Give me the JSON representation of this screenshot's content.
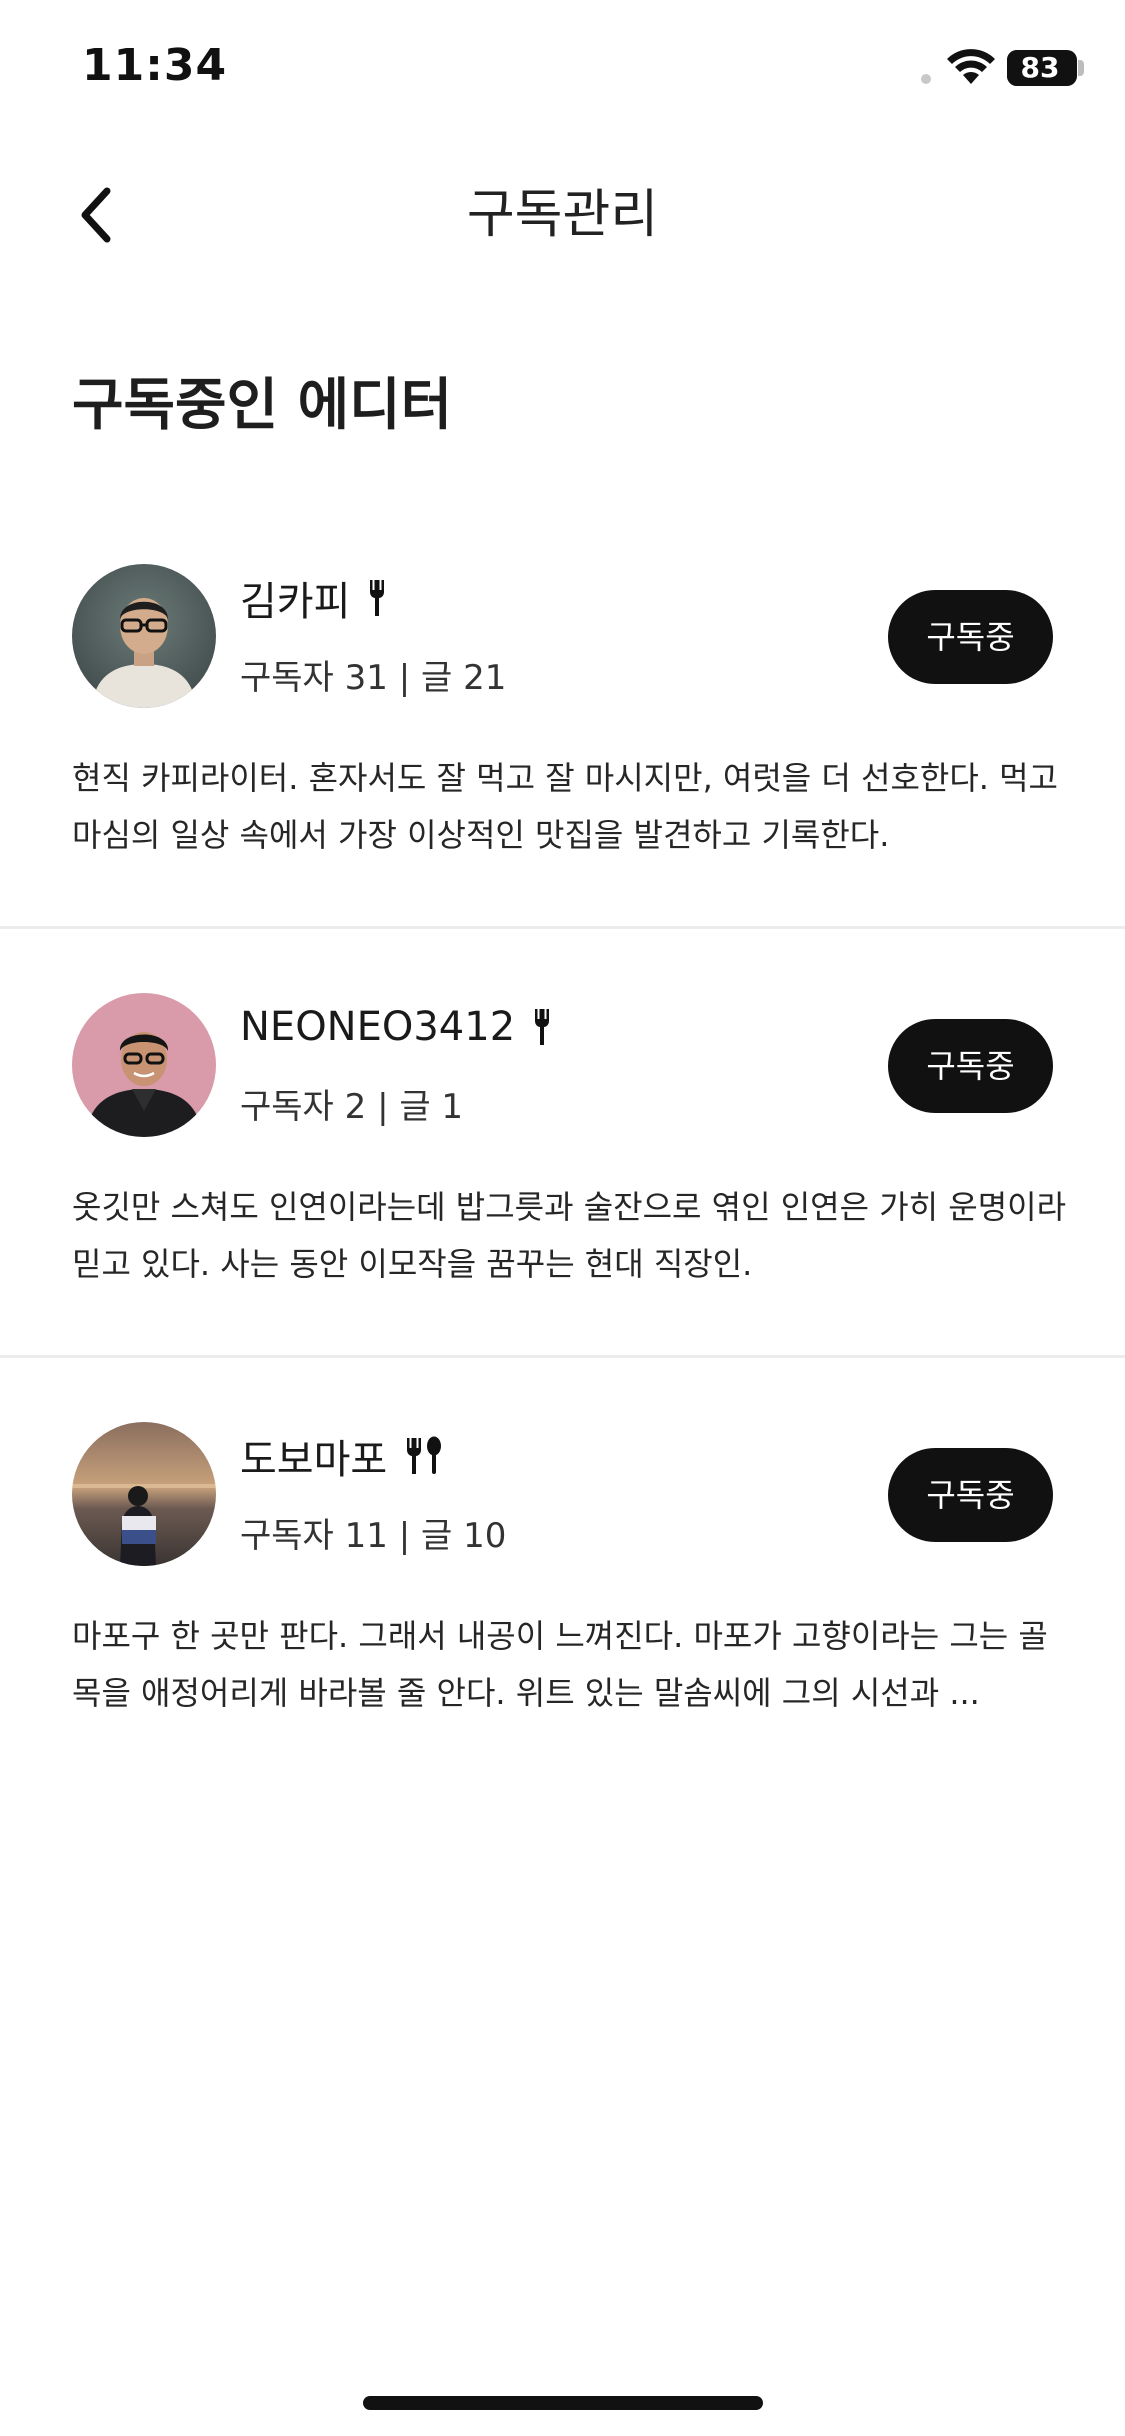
{
  "status_bar": {
    "time": "11:34",
    "battery_percent": "83",
    "battery_level": 0.83
  },
  "nav": {
    "title": "구독관리",
    "back_icon": "chevron-left-icon"
  },
  "section_title": "구독중인 에디터",
  "editors": [
    {
      "name": "김카피",
      "icon": "fork-icon",
      "stats": "구독자 31 | 글 21",
      "button_label": "구독중",
      "description": "현직 카피라이터. 혼자서도 잘 먹고 잘 마시지만, 여럿을 더 선호한다. 먹고 마심의 일상 속에서 가장 이상적인 맛집을 발견하고 기록한다."
    },
    {
      "name": "NEONEO3412",
      "icon": "fork-icon",
      "stats": "구독자 2 | 글 1",
      "button_label": "구독중",
      "description": "옷깃만 스쳐도 인연이라는데 밥그릇과 술잔으로 엮인 인연은 가히 운명이라 믿고 있다. 사는 동안 이모작을 꿈꾸는 현대 직장인."
    },
    {
      "name": "도보마포",
      "icon": "fork-spoon-icon",
      "stats": "구독자 11 | 글 10",
      "button_label": "구독중",
      "description": "마포구 한 곳만 판다. 그래서 내공이 느껴진다. 마포가 고향이라는 그는 골목을 애정어리게 바라볼 줄 안다. 위트 있는 말솜씨에 그의 시선과 ..."
    }
  ]
}
